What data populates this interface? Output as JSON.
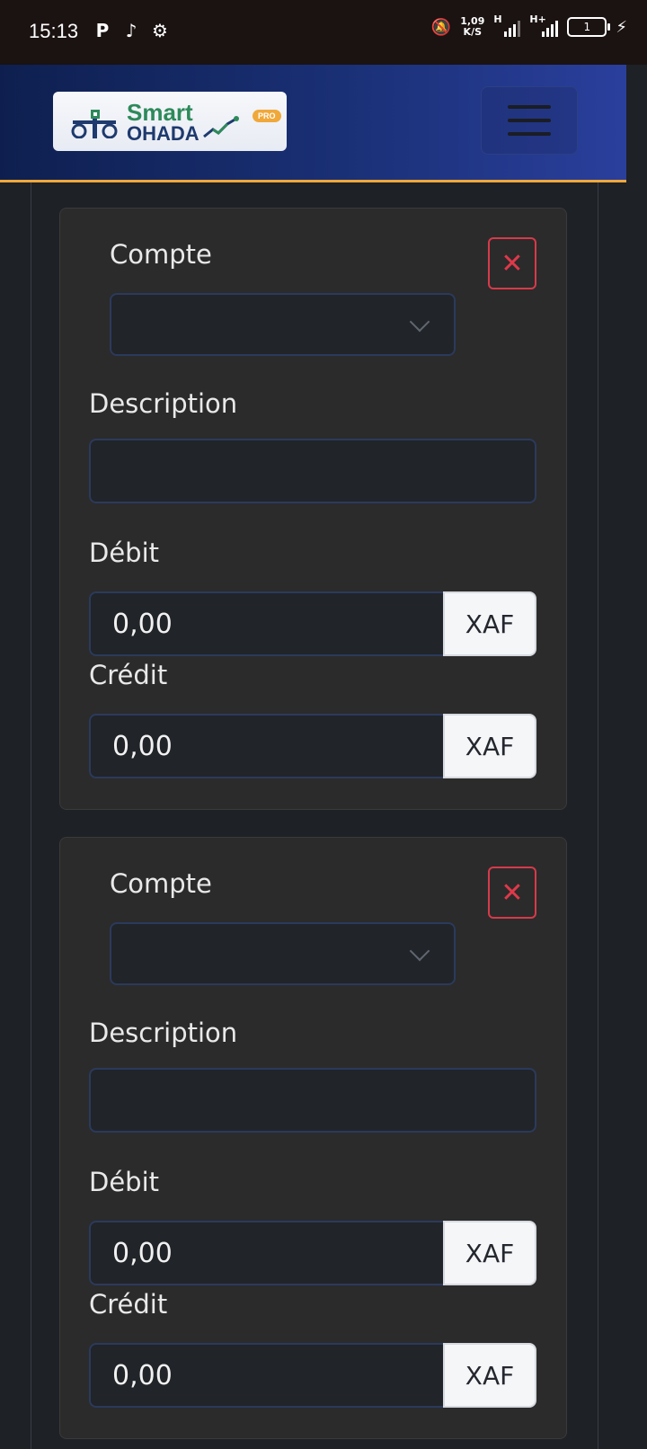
{
  "status_bar": {
    "time": "15:13",
    "net_speed_value": "1,09",
    "net_speed_unit": "K/S",
    "network_1": "H",
    "network_2": "H+",
    "battery_level": "1"
  },
  "header": {
    "brand_line1": "Smart",
    "brand_line2": "OHADA",
    "brand_badge": "PRO",
    "colors": {
      "gradient_start": "#0e1f4f",
      "gradient_end": "#2a3f9c",
      "accent": "#f0a83a"
    }
  },
  "entries": [
    {
      "account_label": "Compte",
      "account_value": "",
      "description_label": "Description",
      "description_value": "",
      "debit_label": "Débit",
      "debit_value": "0,00",
      "debit_currency": "XAF",
      "credit_label": "Crédit",
      "credit_value": "0,00",
      "credit_currency": "XAF",
      "remove_label": "✕"
    },
    {
      "account_label": "Compte",
      "account_value": "",
      "description_label": "Description",
      "description_value": "",
      "debit_label": "Débit",
      "debit_value": "0,00",
      "debit_currency": "XAF",
      "credit_label": "Crédit",
      "credit_value": "0,00",
      "credit_currency": "XAF",
      "remove_label": "✕"
    }
  ]
}
